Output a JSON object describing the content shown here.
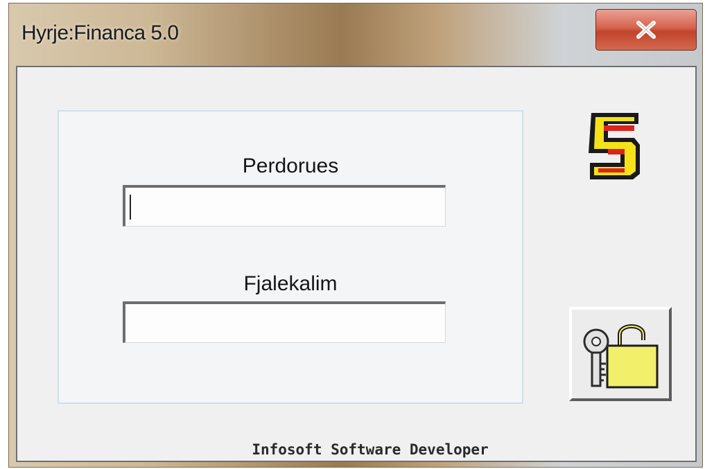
{
  "window": {
    "title": "Hyrje:Financa 5.0"
  },
  "close_button": {
    "icon": "close-icon"
  },
  "login": {
    "username_label": "Perdorues",
    "username_value": "",
    "password_label": "Fjalekalim",
    "password_value": ""
  },
  "logo": {
    "icon": "financa-5-logo",
    "glyph": "5"
  },
  "unlock_button": {
    "icon": "key-and-padlock-icon"
  },
  "footer": {
    "text": "Infosoft Software Developer"
  },
  "colors": {
    "close_button": "#c94f38",
    "logo_fill": "#f5e21a",
    "logo_accent": "#d9251c",
    "padlock": "#f2ef6a"
  }
}
